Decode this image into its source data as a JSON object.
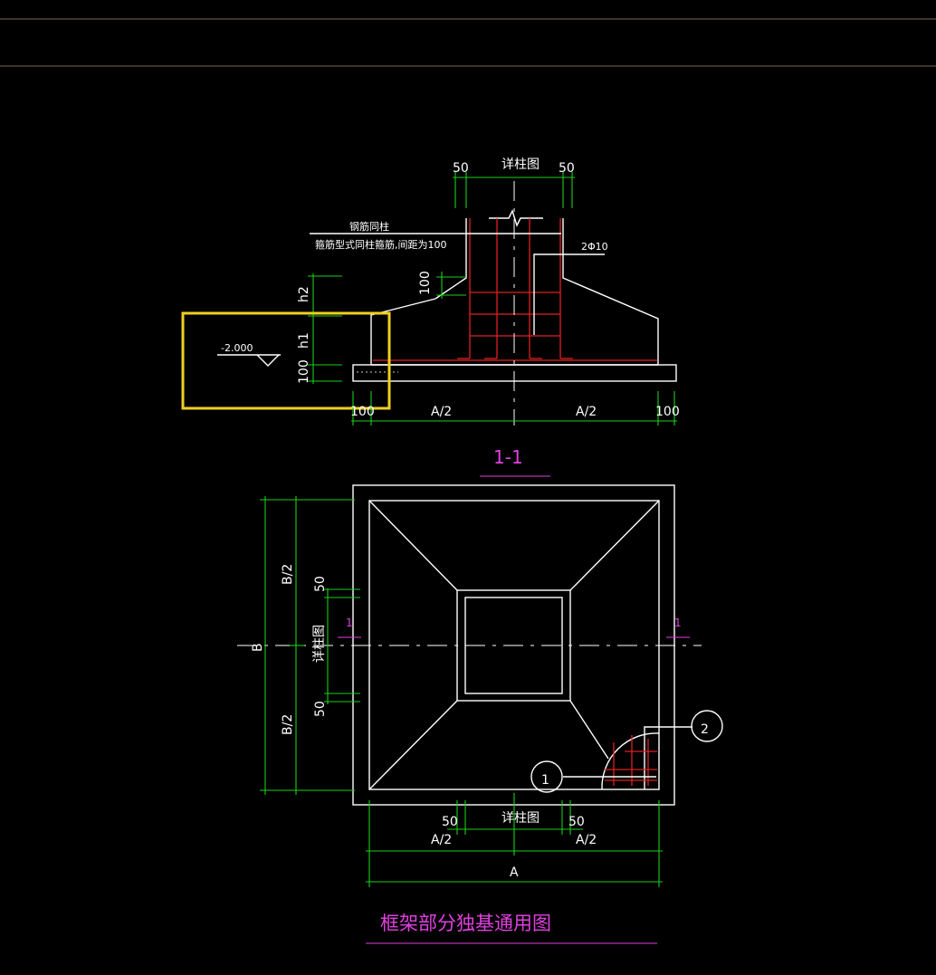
{
  "section": {
    "label_col_detail": "详柱图",
    "dim_50_left": "50",
    "dim_50_right": "50",
    "note_line1": "钢筋同柱",
    "note_line2": "箍筋型式同柱箍筋,间距为100",
    "rebar_callout": "2Φ10",
    "dim_100_vertical": "100",
    "dim_h2": "h2",
    "dim_h1": "h1",
    "dim_100_bottom": "100",
    "elevation": "-2.000",
    "dim_a_half_left": "A/2",
    "dim_a_half_right": "A/2",
    "dim_100_left": "100",
    "dim_100_right": "100",
    "title": "1-1"
  },
  "plan": {
    "cut_mark_left": "1",
    "cut_mark_right": "1",
    "dim_b_half_top": "B/2",
    "dim_b_half_bottom": "B/2",
    "dim_b": "B",
    "dim_50_top": "50",
    "dim_50_bottom": "50",
    "label_col_detail_vertical": "详柱图",
    "bubble_1": "1",
    "bubble_2": "2",
    "dim_50_left": "50",
    "dim_50_right": "50",
    "label_col_detail": "详柱图",
    "dim_a_half_left": "A/2",
    "dim_a_half_right": "A/2",
    "dim_a": "A"
  },
  "drawing_title": "框架部分独基通用图",
  "colors": {
    "background": "#000000",
    "outline": "#ffffff",
    "dimension": "#18d018",
    "rebar": "#e02020",
    "annotation": "#e040e0",
    "highlight": "#f0d020"
  }
}
